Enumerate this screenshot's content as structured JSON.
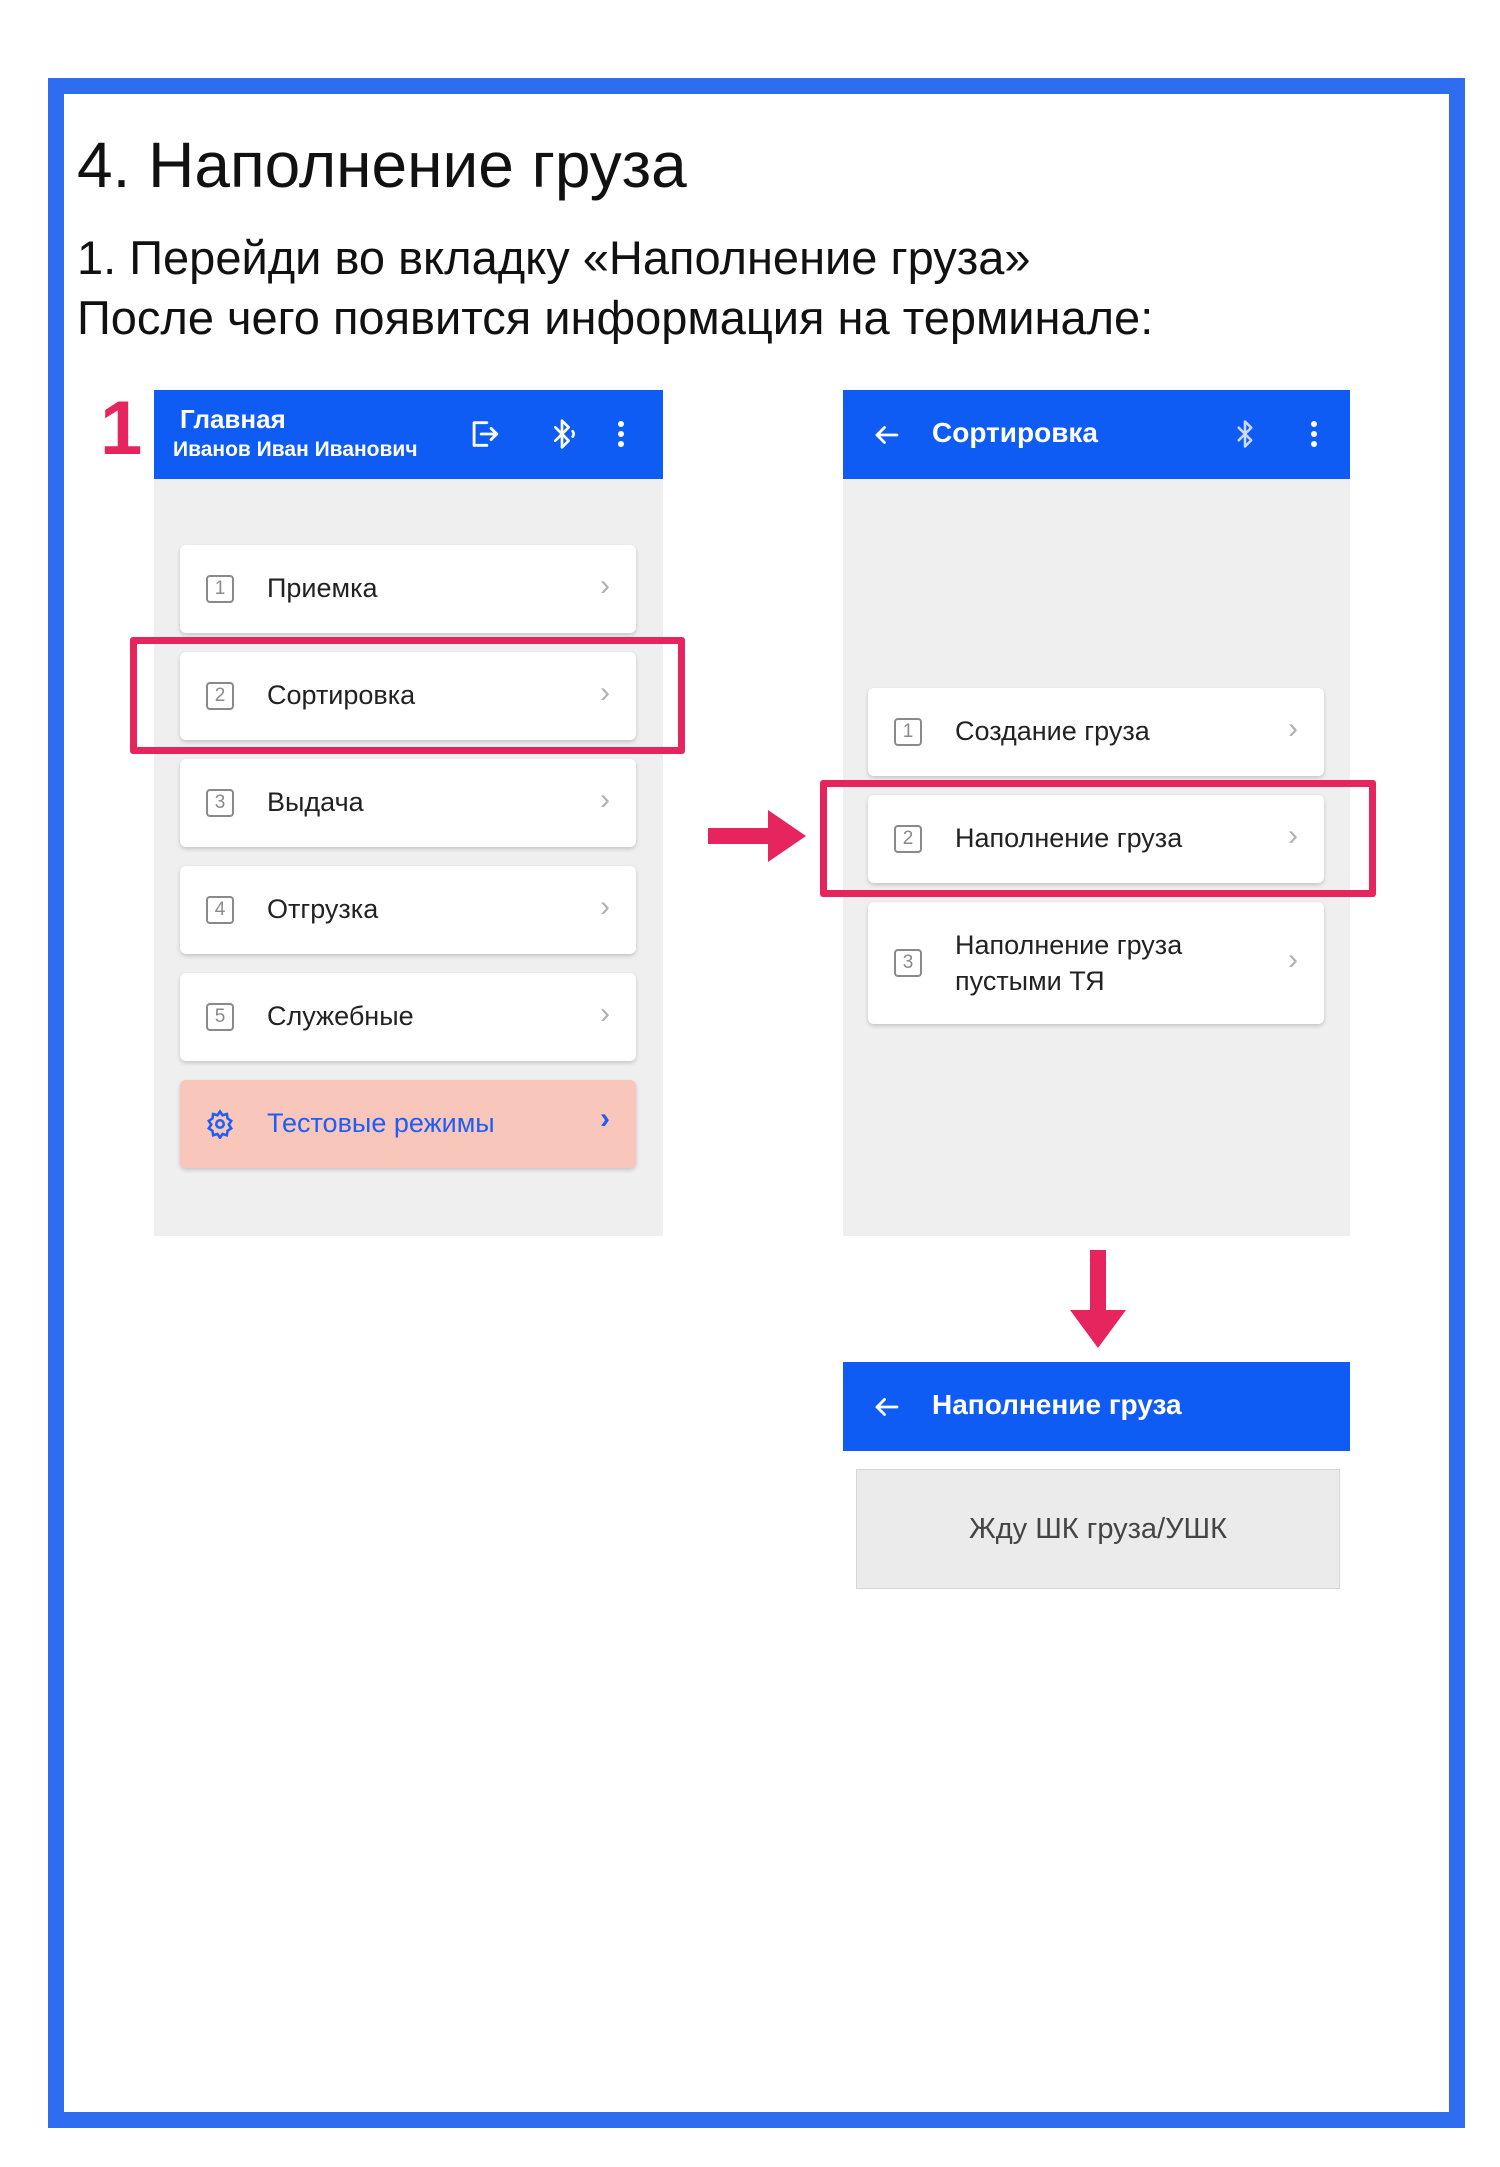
{
  "heading": "4. Наполнение груза",
  "instructions": {
    "line1": "1. Перейди во вкладку «Наполнение груза»",
    "line2": "После чего появится информация на терминале:"
  },
  "step_marker": "1",
  "screen_main": {
    "title": "Главная",
    "user": "Иванов Иван Иванович",
    "icons": [
      "logout-icon",
      "bluetooth-icon",
      "more-vertical-icon"
    ],
    "items": [
      {
        "num": "1",
        "label": "Приемка"
      },
      {
        "num": "2",
        "label": "Сортировка"
      },
      {
        "num": "3",
        "label": "Выдача"
      },
      {
        "num": "4",
        "label": "Отгрузка"
      },
      {
        "num": "5",
        "label": "Служебные"
      }
    ],
    "test_item": {
      "label": "Тестовые режимы",
      "icon": "gear-icon"
    }
  },
  "screen_sort": {
    "title": "Сортировка",
    "items": [
      {
        "num": "1",
        "label": "Создание груза"
      },
      {
        "num": "2",
        "label": "Наполнение груза"
      },
      {
        "num": "3",
        "label_line1": "Наполнение груза",
        "label_line2": "пустыми ТЯ"
      }
    ]
  },
  "screen_fill": {
    "title": "Наполнение груза",
    "status": "Жду ШК груза/УШК"
  },
  "colors": {
    "frame": "#2f6df0",
    "appbar": "#0f5cf5",
    "highlight": "#e6245e",
    "test_bg": "#f8c6bb"
  }
}
